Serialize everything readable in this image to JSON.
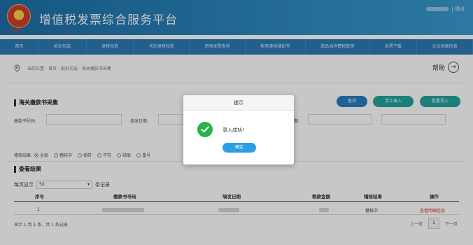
{
  "header": {
    "title": "增值税发票综合服务平台",
    "emblem_text": "中国税务",
    "user_suffix": "| 退出"
  },
  "nav": {
    "items": [
      "首页",
      "抵扣勾选",
      "退税勾选",
      "代办退税勾选",
      "进项发票查询",
      "税务事项通知书",
      "成品油消费税管理",
      "发票下载",
      "企业档案信息"
    ]
  },
  "breadcrumb": {
    "text": "当前位置：首页 - 抵扣勾选 - 海关缴款书采集",
    "help_label": "帮助"
  },
  "collect": {
    "title": "海关缴款书采集",
    "query_label": "查询",
    "manual_label": "手工录入",
    "import_label": "批量导入",
    "field_number_label": "缴款书号码:",
    "field_date_label": "填发日期:",
    "field_status_label": "状态:",
    "field_period_label": "期:",
    "range_sep": "-",
    "check_result_label": "稽核结果:",
    "radios": [
      "全部",
      "稽核中",
      "相符",
      "不符",
      "缺联",
      "重号"
    ]
  },
  "results": {
    "title": "查看结果",
    "per_page_prefix": "每页显示",
    "per_page_value": "50",
    "per_page_suffix": "条记录",
    "columns": [
      "序号",
      "缴款书号码",
      "填发日期",
      "税款金额",
      "稽核结果",
      "操作"
    ],
    "rows": [
      {
        "index": "1",
        "result": "稽核中",
        "action": "查看明细信息"
      }
    ],
    "footer": "显示 1 到 1 条，共 1 条记录",
    "prev_label": "上一页",
    "page_number": "1",
    "next_label": "下一页"
  },
  "modal": {
    "title": "提示",
    "message": "录入成功!",
    "ok_label": "确定"
  },
  "colors": {
    "header_blue": "#2b7ab5",
    "query_button": "#2a7cc4",
    "teal_button": "#24a49a",
    "success_green": "#2bb24c",
    "link_red": "#d23b2a"
  }
}
